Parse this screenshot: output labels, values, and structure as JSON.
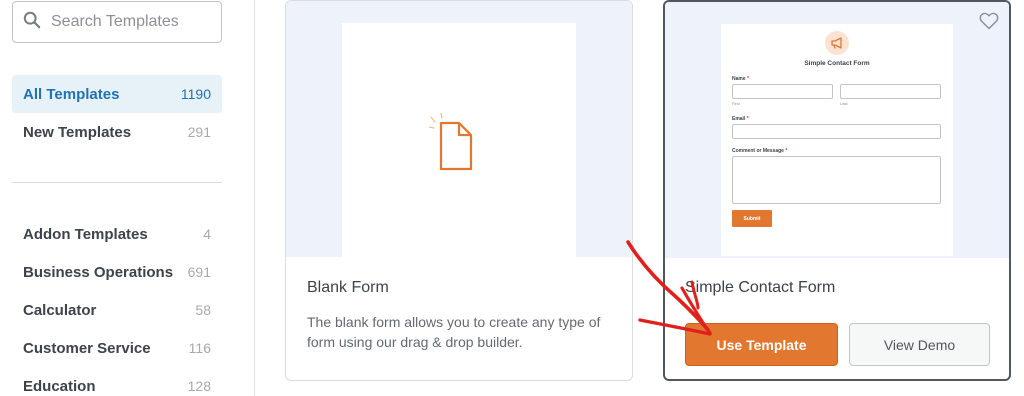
{
  "search": {
    "placeholder": "Search Templates"
  },
  "categories": [
    {
      "label": "All Templates",
      "count": "1190",
      "active": true
    },
    {
      "label": "New Templates",
      "count": "291"
    },
    {
      "label": "Addon Templates",
      "count": "4"
    },
    {
      "label": "Business Operations",
      "count": "691"
    },
    {
      "label": "Calculator",
      "count": "58"
    },
    {
      "label": "Customer Service",
      "count": "116"
    },
    {
      "label": "Education",
      "count": "128"
    }
  ],
  "cards": {
    "blank": {
      "title": "Blank Form",
      "description": "The blank form allows you to create any type of form using our drag & drop builder."
    },
    "contact": {
      "title": "Simple Contact Form",
      "use_label": "Use Template",
      "demo_label": "View Demo",
      "preview": {
        "form_title": "Simple Contact Form",
        "name_label": "Name",
        "first_label": "First",
        "last_label": "Last",
        "email_label": "Email",
        "comment_label": "Comment or Message",
        "submit_label": "Submit",
        "required_mark": "*"
      }
    }
  },
  "colors": {
    "accent": "#e27730",
    "active_blue": "#2271b1",
    "annotation_red": "#e0201b"
  }
}
